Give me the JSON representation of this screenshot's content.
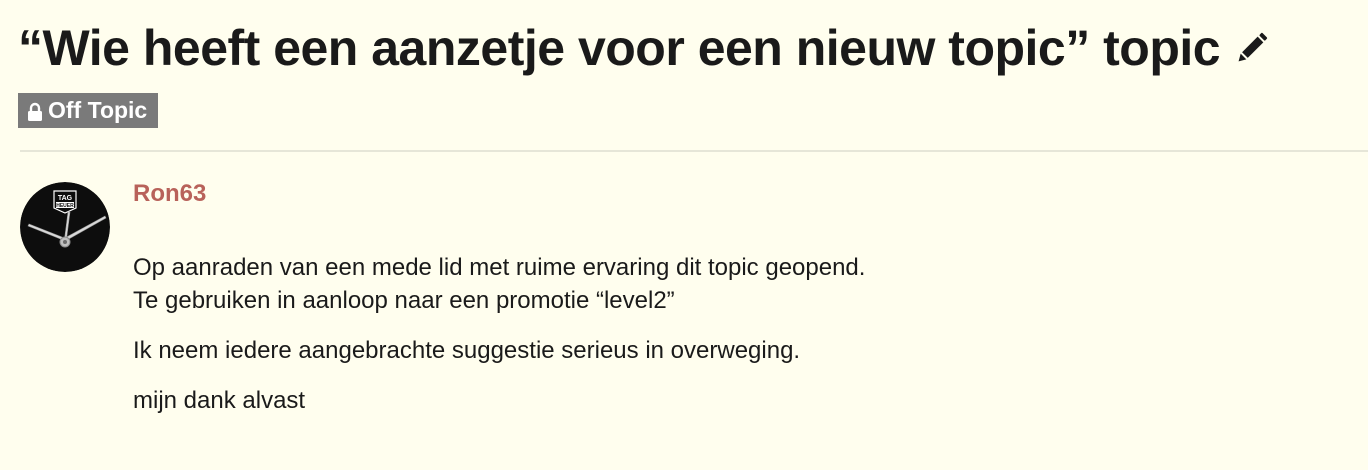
{
  "topic": {
    "title": "“Wie heeft een aanzetje voor een nieuw topic” topic",
    "edit_icon": "pencil-icon"
  },
  "category": {
    "label": "Off Topic",
    "icon": "lock-icon",
    "color": "#7a7a7a"
  },
  "post": {
    "username": "Ron63",
    "username_color": "#b8625a",
    "avatar_logo_text_top": "TAG",
    "avatar_logo_text_bottom": "HEUER",
    "paragraphs": [
      {
        "line1": "Op aanraden van een mede lid met ruime ervaring dit topic geopend.",
        "line2": "Te gebruiken in aanloop naar een promotie “level2”"
      },
      {
        "line1": "Ik neem iedere aangebrachte suggestie serieus in overweging."
      },
      {
        "line1": "mijn dank alvast"
      }
    ]
  },
  "colors": {
    "background": "#fffeee",
    "divider": "#e6e6d8"
  }
}
